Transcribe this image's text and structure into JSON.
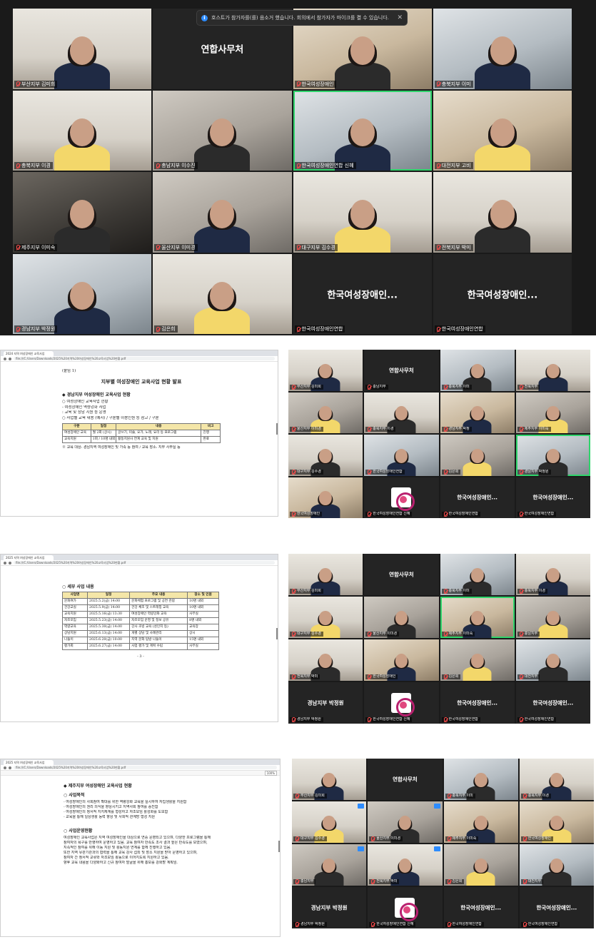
{
  "notification": {
    "text": "호스트가 참가자를(를) 음소거 했습니다. 회의에서 참가자가 마이크를 켤 수 있습니다."
  },
  "gallery_main": {
    "tiles": [
      {
        "name": "부산지부 김미희",
        "style": "room"
      },
      {
        "name": "",
        "label": "연합사무처",
        "style": "black"
      },
      {
        "name": "한국여성장애인",
        "style": "warm"
      },
      {
        "name": "충북지부 이미",
        "style": "cool"
      },
      {
        "name": "충북지부 이경",
        "style": "room"
      },
      {
        "name": "충남지부 이수진",
        "style": "cam"
      },
      {
        "name": "한국여성장애인연합 신혜",
        "style": "cool",
        "speaking": true
      },
      {
        "name": "대전지부 고비",
        "style": "warm"
      },
      {
        "name": "제주지부 이미숙",
        "style": "dark"
      },
      {
        "name": "울산지부 이미경",
        "style": "cam"
      },
      {
        "name": "대구지부 김수경",
        "style": "room"
      },
      {
        "name": "전북지부 박미",
        "style": "room"
      },
      {
        "name": "경남지부 박정원",
        "style": "cool"
      },
      {
        "name": "김은희",
        "style": "room"
      },
      {
        "name": "한국여성장애인연합",
        "label": "한국여성장애인...",
        "style": "black"
      },
      {
        "name": "한국여성장애인연합",
        "label": "한국여성장애인...",
        "style": "black"
      }
    ]
  },
  "doc1": {
    "tab": "2024 지역 여성장애인 교육사업",
    "url": "file:///C:/Users/Downloads/2025%20지역%20여성장애인%20교육사업%20현황.pdf",
    "label": "(붙임 1)",
    "title": "지부별 여성장애인 교육사업 현황 발표",
    "section": "◆ 경남지부 여성장애인 교육사업 현황",
    "lines": [
      "○ 여성장애인 교육사업 현황",
      " - 여성장애인 역량강화 사업",
      "   : 교육 및 상담 지원 등 운영",
      "○ 사업별 교육 내용 (예시) / 구분별 이용인원 등 참고 / 구분"
    ],
    "table_head": [
      "구분",
      "일정",
      "내용",
      "비고"
    ],
    "table_rows": [
      [
        "여성장애인 교육",
        "월 2회 (상시)",
        "글쓰기, 미술, 요가, 노래, 요리 등 프로그램",
        "진행"
      ],
      [
        "교육지원",
        "1회 / 10명 내외",
        "활동지원사 연계 교육 및 지원",
        "완료"
      ]
    ],
    "footer": "※ 교육 대상: 경남지역 여성장애인 및 가족 등 참여 / 교육 장소: 지부 사무실 등"
  },
  "doc2": {
    "tab": "2025 지역 여성장애인 교육사업",
    "url": "file:///C:/Users/Downloads/2025%20지역%20여성장애인%20교육사업%20현황.pdf",
    "section": "○ 세부 사업 내용",
    "table_head": [
      "사업명",
      "일정",
      "주요 내용",
      "장소 및 인원"
    ],
    "table_rows": [
      [
        "문화여가",
        "2025.5.2(금) 14:00",
        "문화체험 프로그램 및 공연 관람",
        "10명 내외"
      ],
      [
        "건강교실",
        "2025.5.9(금) 14:00",
        "건강 체조 및 스트레칭 교육",
        "10명 내외"
      ],
      [
        "교육지원",
        "2025.5.16(금) 13:30",
        "여성장애인 역량강화 교육",
        "사무실"
      ],
      [
        "자조모임",
        "2025.5.23(금) 14:00",
        "자조모임 운영 및 정보 공유",
        "8명 내외"
      ],
      [
        "역량교육",
        "2025.5.30(금) 14:00",
        "강사 초빙 교육 (성인지 등)",
        "교육장"
      ],
      [
        "상담지원",
        "2025.6.13(금) 14:00",
        "개별 상담 및 사례관리",
        "상시"
      ],
      [
        "나들이",
        "2025.6.20(금) 10:00",
        "지역 문화 탐방 나들이",
        "15명 내외"
      ],
      [
        "평가회",
        "2025.6.27(금) 14:00",
        "사업 평가 및 계획 수립",
        "사무실"
      ]
    ],
    "page": "- 3 -"
  },
  "doc3": {
    "tab": "2025 지역 여성장애인 교육사업",
    "url": "file:///C:/Users/Downloads/2025%20지역%20여성장애인%20교육사업%20현황.pdf",
    "zoom": "100%",
    "section": "◆ 제주지부 여성장애인 교육사업 현황",
    "sub1": "○ 사업목적",
    "lines1": [
      " - 여성장애인의 사회참여 확대를 위한 역량강화 교육을 실시하여 자립생활을 지원함",
      " - 여성장애인의 권리 의식을 향상시키고 지역사회 참여를 증진함",
      " - 여성장애인의 정서적 지지체계를 형성하고 자조모임 활성화를 도모함",
      " - 교육을 통해 일상생활 능력 향상 및 사회적 관계망 형성 지원"
    ],
    "sub2": "○ 사업운영현황",
    "lines2": [
      " 여성장애인 교육사업은 지역 여성장애인을 대상으로 연중 운영되고 있으며, 다양한 프로그램을 통해",
      " 참여자의 욕구를 반영하여 운영하고 있음. 교육 참여자 만족도 조사 결과 높은 만족도를 보였으며,",
      " 지속적인 참여를 위해 이동 지원 및 활동지원 연계를 함께 진행하고 있음.",
      " 또한 지역 유관기관과의 협력을 통해 교육 강사 섭외 및 장소 지원을 받아 운영하고 있으며,",
      " 참여자 간 정서적 교류와 자조모임 활동으로 이어지도록 지원하고 있음.",
      " 향후 교육 내용을 다양화하고 신규 참여자 발굴을 위해 홍보를 강화할 계획임."
    ]
  },
  "gallery_small_1": {
    "tiles": [
      {
        "name": "부산지부 김미희",
        "style": "room"
      },
      {
        "name": "충남지부",
        "label": "연합사무처",
        "style": "black"
      },
      {
        "name": "충북지부 이미",
        "style": "cool"
      },
      {
        "name": "전북지부",
        "style": "room"
      },
      {
        "name": "울산지부 이미경",
        "style": "cam"
      },
      {
        "name": "충북지부 이경",
        "style": "room"
      },
      {
        "name": "경남지부 박정",
        "style": "warm"
      },
      {
        "name": "제주지부 이미숙",
        "style": "cam"
      },
      {
        "name": "대구지부 김수경",
        "style": "room"
      },
      {
        "name": "한국여성장애인연합",
        "style": "cool"
      },
      {
        "name": "김은희",
        "style": "cam"
      },
      {
        "name": "경남지부 박정원",
        "style": "cool",
        "speaking": true
      },
      {
        "name": "한국여성장애인",
        "style": "warm"
      },
      {
        "name": "한국여성장애인연합 신혜",
        "logo": true,
        "style": "black"
      },
      {
        "name": "한국여성장애인연합",
        "label": "한국여성장애인...",
        "style": "black"
      },
      {
        "name": "한국여성장애인연합",
        "label": "한국여성장애인...",
        "style": "black"
      }
    ]
  },
  "gallery_small_2": {
    "tiles": [
      {
        "name": "부산지부 김미희",
        "style": "room"
      },
      {
        "name": "",
        "label": "연합사무처",
        "style": "black"
      },
      {
        "name": "충북지부 이미",
        "style": "cool"
      },
      {
        "name": "충북지부 이경",
        "style": "room"
      },
      {
        "name": "대구지부 김수경",
        "style": "room"
      },
      {
        "name": "울산지부 이미경",
        "style": "cam"
      },
      {
        "name": "제주지부 이미숙",
        "style": "warm",
        "speaking": true
      },
      {
        "name": "충남지부",
        "style": "cam"
      },
      {
        "name": "전북지부 박미",
        "style": "room"
      },
      {
        "name": "한국여성장애인",
        "style": "warm"
      },
      {
        "name": "김은희",
        "style": "cam"
      },
      {
        "name": "대전지부",
        "style": "cool"
      },
      {
        "name": "경남지부 박정원",
        "label": "경남지부 박정원",
        "style": "black"
      },
      {
        "name": "한국여성장애인연합 신혜",
        "logo": true,
        "style": "black"
      },
      {
        "name": "한국여성장애인연합",
        "label": "한국여성장애인...",
        "style": "black"
      },
      {
        "name": "한국여성장애인연합",
        "label": "한국여성장애인...",
        "style": "black"
      }
    ]
  },
  "gallery_small_3": {
    "tiles": [
      {
        "name": "부산지부 김미희",
        "style": "room"
      },
      {
        "name": "",
        "label": "연합사무처",
        "style": "black"
      },
      {
        "name": "충북지부 이미",
        "style": "cool"
      },
      {
        "name": "충북지부 이경",
        "style": "room"
      },
      {
        "name": "대구지부 김수경",
        "style": "room"
      },
      {
        "name": "울산지부 이미경",
        "style": "cam"
      },
      {
        "name": "제주지부 이미숙",
        "style": "warm"
      },
      {
        "name": "한국여성장애인",
        "style": "warm"
      },
      {
        "name": "충남지부",
        "style": "cam"
      },
      {
        "name": "전북지부 박미",
        "style": "room"
      },
      {
        "name": "김은희",
        "style": "cam"
      },
      {
        "name": "대전지부",
        "style": "cool"
      },
      {
        "name": "경남지부 박정원",
        "label": "경남지부 박정원",
        "style": "black"
      },
      {
        "name": "한국여성장애인연합 신혜",
        "logo": true,
        "style": "black"
      },
      {
        "name": "한국여성장애인연합",
        "label": "한국여성장애인...",
        "style": "black"
      },
      {
        "name": "한국여성장애인연합",
        "label": "한국여성장애인...",
        "style": "black"
      }
    ]
  },
  "colors": {
    "zoom_bg": "#1a1a1a",
    "tile_bg": "#232323",
    "active_speaker": "#2fd46b",
    "mic_muted": "#ff4d4d",
    "table_header": "#f4e6a8",
    "logo_accent": "#b9206f"
  }
}
